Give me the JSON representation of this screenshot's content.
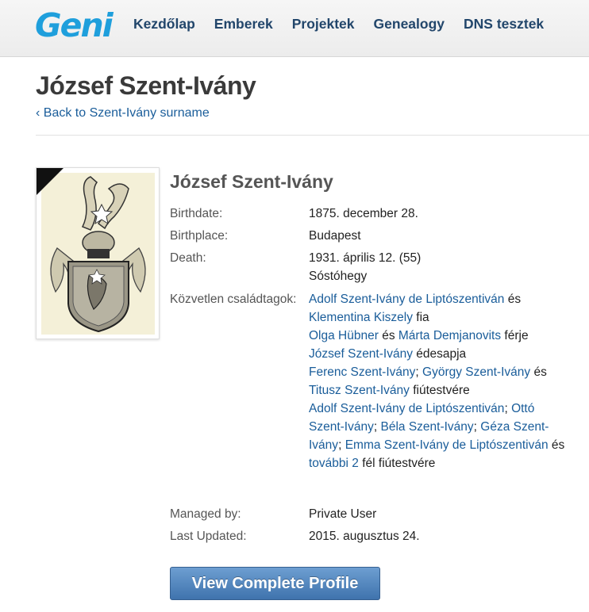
{
  "header": {
    "logo": "Geni",
    "nav": [
      "Kezdőlap",
      "Emberek",
      "Projektek",
      "Genealogy",
      "DNS tesztek"
    ]
  },
  "page": {
    "title": "József Szent-Ivány",
    "back_link": "‹ Back to Szent-Ivány surname"
  },
  "profile": {
    "name": "József Szent-Ivány",
    "birthdate_label": "Birthdate:",
    "birthdate": "1875. december 28.",
    "birthplace_label": "Birthplace:",
    "birthplace": "Budapest",
    "death_label": "Death:",
    "death_date": "1931. április 12. (55)",
    "death_place": "Sóstóhegy",
    "family_label": "Közvetlen családtagok:",
    "family": {
      "parent1": "Adolf Szent-Ivány de Liptószentiván",
      "and": "és",
      "parent2": "Klementina Kiszely",
      "son_of": "fia",
      "spouse1": "Olga Hübner",
      "and2": "és",
      "spouse2": "Márta Demjanovits",
      "husband_of": "férje",
      "child1": "József Szent-Ivány",
      "father_of": "édesapja",
      "bro1": "Ferenc Szent-Ivány",
      "sep1": ";",
      "bro2": "György Szent-Ivány",
      "and3": "és",
      "bro3": "Titusz Szent-Ivány",
      "brother_of": "fiútestvére",
      "half1": "Adolf Szent-Ivány de Liptószentiván",
      "sep2": ";",
      "half2": "Ottó Szent-Ivány",
      "sep3": ";",
      "half3": "Béla Szent-Ivány",
      "sep4": ";",
      "half4": "Géza Szent-Ivány",
      "sep5": ";",
      "half5": "Emma Szent-Ivány de Liptószentiván",
      "and4": "és",
      "more": "további 2",
      "half_brother_of": "fél fiútestvére"
    },
    "managed_label": "Managed by:",
    "managed_by": "Private User",
    "updated_label": "Last Updated:",
    "last_updated": "2015. augusztus 24.",
    "button": "View Complete Profile"
  }
}
